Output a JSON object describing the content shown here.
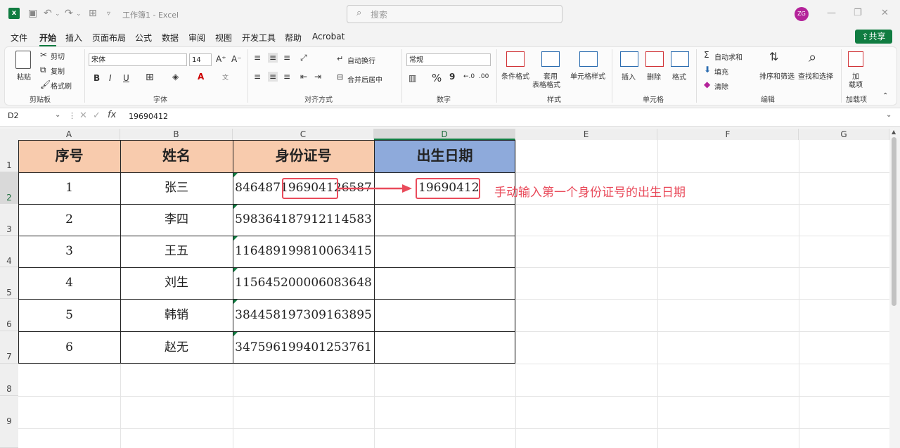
{
  "title_bar": {
    "doc_title": "工作簿1 - Excel",
    "search_placeholder": "搜索",
    "avatar_initials": "ZG"
  },
  "menu": [
    "文件",
    "开始",
    "插入",
    "页面布局",
    "公式",
    "数据",
    "审阅",
    "视图",
    "开发工具",
    "帮助",
    "Acrobat"
  ],
  "share_label": "共享",
  "ribbon": {
    "clipboard": {
      "paste": "粘贴",
      "cut": "剪切",
      "copy": "复制",
      "format_painter": "格式刷",
      "label": "剪贴板"
    },
    "font": {
      "name": "宋体",
      "size": "14",
      "label": "字体",
      "bold": "B",
      "italic": "I",
      "underline": "U"
    },
    "alignment": {
      "wrap": "自动换行",
      "merge": "合并后居中",
      "label": "对齐方式"
    },
    "number": {
      "format": "常规",
      "percent": "%",
      "comma": "9",
      "label": "数字"
    },
    "styles": {
      "conditional": "条件格式",
      "table_a": "套用",
      "table_b": "表格格式",
      "cell_styles": "单元格样式",
      "label": "样式"
    },
    "cells": {
      "insert": "插入",
      "delete": "删除",
      "format": "格式",
      "label": "单元格"
    },
    "editing": {
      "autosum": "自动求和",
      "fill": "填充",
      "clear": "清除",
      "sort": "排序和筛选",
      "find": "查找和选择",
      "label": "编辑"
    },
    "addins": {
      "a": "加",
      "b": "载项",
      "label": "加载项"
    }
  },
  "formula_bar": {
    "name_box": "D2",
    "fx": "fx",
    "value": "19690412"
  },
  "columns": [
    "A",
    "B",
    "C",
    "D",
    "E",
    "F",
    "G"
  ],
  "rows": [
    "1",
    "2",
    "3",
    "4",
    "5",
    "6",
    "7",
    "8",
    "9"
  ],
  "table": {
    "headers": [
      "序号",
      "姓名",
      "身份证号",
      "出生日期"
    ],
    "data": [
      [
        "1",
        "张三",
        "846487196904126587",
        "19690412"
      ],
      [
        "2",
        "李四",
        "598364187912114583",
        ""
      ],
      [
        "3",
        "王五",
        "116489199810063415",
        ""
      ],
      [
        "4",
        "刘生",
        "115645200006083648",
        ""
      ],
      [
        "5",
        "韩销",
        "384458197309163895",
        ""
      ],
      [
        "6",
        "赵无",
        "347596199401253761",
        ""
      ]
    ]
  },
  "annotation": {
    "text": "手动输入第一个身份证号的出生日期",
    "id_prefix": "846487",
    "id_highlight": "19690412",
    "id_suffix": "6587",
    "color": "#e94b5b"
  },
  "colors": {
    "header_orange": "#f8cbad",
    "header_blue": "#8eaadb",
    "excel_green": "#107c41"
  }
}
